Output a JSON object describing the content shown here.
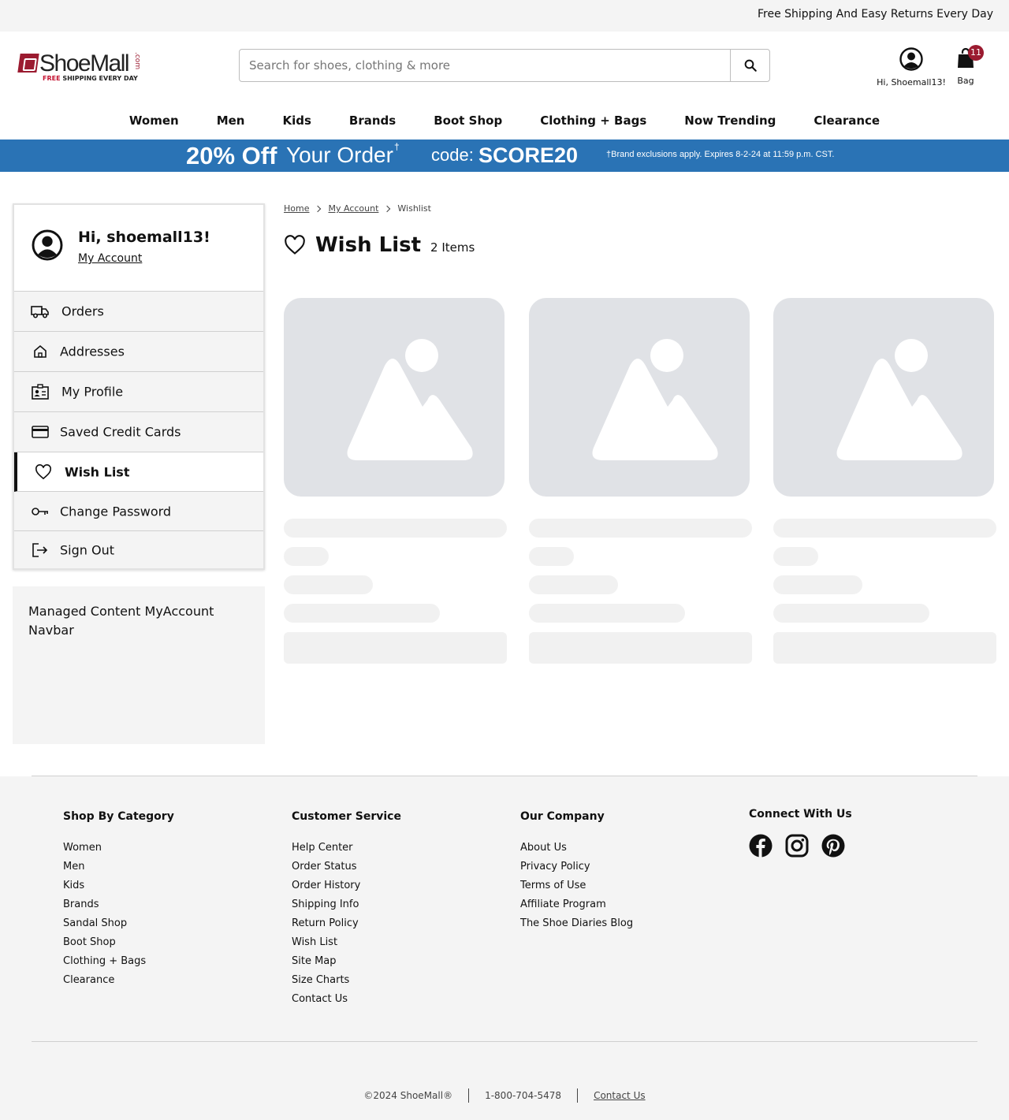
{
  "topbar": {
    "message": "Free Shipping And Easy Returns Every Day"
  },
  "logo": {
    "name": "ShoeMall",
    "dotcom": ".com",
    "tag_free": "FREE",
    "tag_rest": " SHIPPING EVERY DAY"
  },
  "search": {
    "placeholder": "Search for shoes, clothing & more"
  },
  "account": {
    "label": "Hi, Shoemall13!"
  },
  "bag": {
    "label": "Bag",
    "count": "11"
  },
  "nav": [
    "Women",
    "Men",
    "Kids",
    "Brands",
    "Boot Shop",
    "Clothing + Bags",
    "Now Trending",
    "Clearance"
  ],
  "promo": {
    "headline": "20% Off",
    "sub": "Your Order",
    "dagger": "†",
    "code_label": "code:",
    "code": "SCORE20",
    "fine": "†Brand exclusions apply. Expires 8-2-24 at 11:59 p.m. CST.",
    "color": "#2a73b5"
  },
  "sidebar": {
    "greeting": "Hi, shoemall13!",
    "my_account": "My Account",
    "items": [
      {
        "label": "Orders",
        "icon": "truck-icon"
      },
      {
        "label": "Addresses",
        "icon": "house-icon"
      },
      {
        "label": "My Profile",
        "icon": "id-card-icon"
      },
      {
        "label": "Saved Credit Cards",
        "icon": "credit-card-icon"
      },
      {
        "label": "Wish List",
        "icon": "heart-icon",
        "active": true
      },
      {
        "label": "Change Password",
        "icon": "key-icon"
      },
      {
        "label": "Sign Out",
        "icon": "sign-out-icon"
      }
    ],
    "managed": "Managed Content MyAccount Navbar"
  },
  "breadcrumb": {
    "home": "Home",
    "account": "My Account",
    "current": "Wishlist"
  },
  "wishlist": {
    "title": "Wish List",
    "count": "2 Items"
  },
  "footer": {
    "shop": {
      "title": "Shop By Category",
      "links": [
        "Women",
        "Men",
        "Kids",
        "Brands",
        "Sandal Shop",
        "Boot Shop",
        "Clothing + Bags",
        "Clearance"
      ]
    },
    "service": {
      "title": "Customer Service",
      "links": [
        "Help Center",
        "Order Status",
        "Order History",
        "Shipping Info",
        "Return Policy",
        "Wish List",
        "Site Map",
        "Size Charts",
        "Contact Us"
      ]
    },
    "company": {
      "title": "Our Company",
      "links": [
        "About Us",
        "Privacy Policy",
        "Terms of Use",
        "Affiliate Program",
        "The Shoe Diaries Blog"
      ]
    },
    "connect": {
      "title": "Connect With Us"
    },
    "copyright": "©2024 ShoeMall®",
    "phone": "1-800-704-5478",
    "contact": "Contact Us"
  },
  "colors": {
    "brand": "#9b1b30",
    "placeholder": "#e0e2e6"
  }
}
